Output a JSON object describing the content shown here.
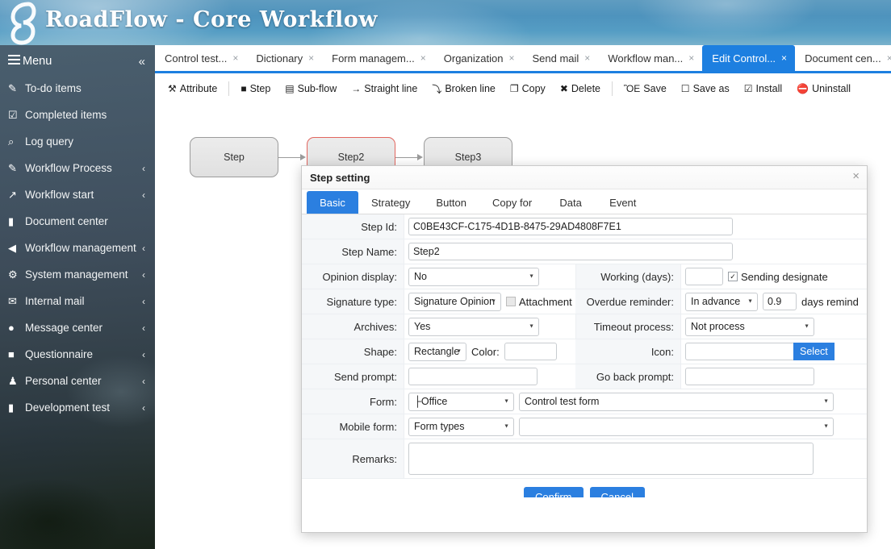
{
  "header": {
    "title": "RoadFlow - Core  Workflow",
    "logo_icon": "roadflow-logo-icon"
  },
  "sidebar": {
    "menu_label": "Menu",
    "menu_icon": "hamburger-icon",
    "collapse_icon": "«",
    "arrow_icon": "‹",
    "items": [
      {
        "label": "To-do items",
        "icon": "edit-square-icon",
        "icon_glyph": "✎",
        "has_arrow": false
      },
      {
        "label": "Completed items",
        "icon": "check-square-icon",
        "icon_glyph": "☑",
        "has_arrow": false
      },
      {
        "label": "Log query",
        "icon": "search-icon",
        "icon_glyph": "⌕",
        "has_arrow": false
      },
      {
        "label": "Workflow Process",
        "icon": "pencil-square-icon",
        "icon_glyph": "✎",
        "has_arrow": true
      },
      {
        "label": "Workflow start",
        "icon": "arrow-square-icon",
        "icon_glyph": "↗",
        "has_arrow": true
      },
      {
        "label": "Document center",
        "icon": "briefcase-icon",
        "icon_glyph": "▮",
        "has_arrow": false
      },
      {
        "label": "Workflow management",
        "icon": "share-square-icon",
        "icon_glyph": "◀",
        "has_arrow": true
      },
      {
        "label": "System management",
        "icon": "gear-icon",
        "icon_glyph": "⚙",
        "has_arrow": true
      },
      {
        "label": "Internal mail",
        "icon": "envelope-icon",
        "icon_glyph": "✉",
        "has_arrow": true
      },
      {
        "label": "Message center",
        "icon": "chat-bubble-icon",
        "icon_glyph": "●",
        "has_arrow": true
      },
      {
        "label": "Questionnaire",
        "icon": "clipboard-icon",
        "icon_glyph": "■",
        "has_arrow": true
      },
      {
        "label": "Personal center",
        "icon": "user-icon",
        "icon_glyph": "♟",
        "has_arrow": true
      },
      {
        "label": "Development test",
        "icon": "bookmark-icon",
        "icon_glyph": "▮",
        "has_arrow": true
      }
    ]
  },
  "tabs": {
    "close_glyph": "×",
    "items": [
      {
        "label": "Control test...",
        "active": false
      },
      {
        "label": "Dictionary",
        "active": false
      },
      {
        "label": "Form managem...",
        "active": false
      },
      {
        "label": "Organization",
        "active": false
      },
      {
        "label": "Send mail",
        "active": false
      },
      {
        "label": "Workflow man...",
        "active": false
      },
      {
        "label": "Edit Control...",
        "active": true
      },
      {
        "label": "Document cen...",
        "active": false
      }
    ]
  },
  "toolbar": {
    "buttons": [
      {
        "label": "Attribute",
        "icon": "wrench-icon",
        "glyph": "⚒",
        "sep_after": true
      },
      {
        "label": "Step",
        "icon": "step-square-icon",
        "glyph": "■",
        "sep_after": false
      },
      {
        "label": "Sub-flow",
        "icon": "subflow-icon",
        "glyph": "▤",
        "sep_after": false
      },
      {
        "label": "Straight line",
        "icon": "straight-line-icon",
        "glyph": "→",
        "sep_after": false
      },
      {
        "label": "Broken line",
        "icon": "broken-line-icon",
        "glyph": "⤵",
        "sep_after": false
      },
      {
        "label": "Copy",
        "icon": "copy-icon",
        "glyph": "❐",
        "sep_after": false
      },
      {
        "label": "Delete",
        "icon": "delete-x-icon",
        "glyph": "✖",
        "sep_after": true
      },
      {
        "label": "Save",
        "icon": "save-disk-icon",
        "glyph": "ὋE",
        "sep_after": false
      },
      {
        "label": "Save as",
        "icon": "save-as-icon",
        "glyph": "☐",
        "sep_after": false
      },
      {
        "label": "Install",
        "icon": "install-check-icon",
        "glyph": "☑",
        "sep_after": false
      },
      {
        "label": "Uninstall",
        "icon": "uninstall-icon",
        "glyph": "⛔",
        "sep_after": false
      }
    ]
  },
  "canvas": {
    "nodes": [
      {
        "label": "Step",
        "selected": false
      },
      {
        "label": "Step2",
        "selected": true
      },
      {
        "label": "Step3",
        "selected": false
      }
    ]
  },
  "dialog": {
    "title": "Step setting",
    "close_glyph": "×",
    "tabs": [
      {
        "label": "Basic",
        "active": true
      },
      {
        "label": "Strategy",
        "active": false
      },
      {
        "label": "Button",
        "active": false
      },
      {
        "label": "Copy for",
        "active": false
      },
      {
        "label": "Data",
        "active": false
      },
      {
        "label": "Event",
        "active": false
      }
    ],
    "fields": {
      "step_id_label": "Step Id:",
      "step_id_value": "C0BE43CF-C175-4D1B-8475-29AD4808F7E1",
      "step_name_label": "Step Name:",
      "step_name_value": "Step2",
      "opinion_display_label": "Opinion display:",
      "opinion_display_value": "No",
      "working_days_label": "Working (days):",
      "working_days_value": "",
      "sending_designate_label": "Sending designate",
      "sending_designate_checked": true,
      "signature_type_label": "Signature type:",
      "signature_type_value": "Signature Opinion",
      "attachment_label": "Attachment",
      "attachment_checked": false,
      "overdue_reminder_label": "Overdue reminder:",
      "overdue_reminder_value": "In advance",
      "overdue_days_value": "0.9",
      "days_remind_label": "days remind",
      "archives_label": "Archives:",
      "archives_value": "Yes",
      "timeout_process_label": "Timeout process:",
      "timeout_process_value": "Not process",
      "shape_label": "Shape:",
      "shape_value": "Rectangle",
      "color_label": "Color:",
      "color_value": "",
      "icon_label": "Icon:",
      "icon_value": "",
      "select_button_label": "Select",
      "send_prompt_label": "Send prompt:",
      "send_prompt_value": "",
      "go_back_prompt_label": "Go back prompt:",
      "go_back_prompt_value": "",
      "form_label": "Form:",
      "form_type_value": "├Office",
      "form_name_value": "Control test form",
      "mobile_form_label": "Mobile form:",
      "mobile_form_type_value": "Form types",
      "mobile_form_name_value": "",
      "remarks_label": "Remarks:",
      "remarks_value": ""
    },
    "confirm_label": "Confirm",
    "cancel_label": "Cancel"
  },
  "colors": {
    "accent_blue": "#2b7fe0",
    "tab_active_blue": "#1d7fe0",
    "selected_node_red": "#e2665f",
    "label_bg": "#f5f7f9"
  }
}
